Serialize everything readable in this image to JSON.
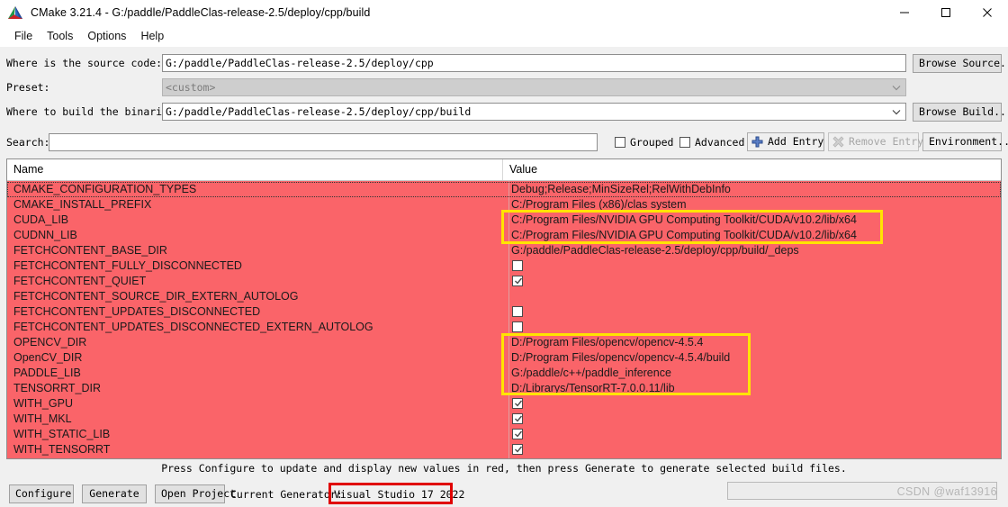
{
  "window": {
    "title": "CMake 3.21.4 - G:/paddle/PaddleClas-release-2.5/deploy/cpp/build",
    "logo_icon": "cmake-logo-icon",
    "minimize_icon": "minimize-icon",
    "maximize_icon": "maximize-icon",
    "close_icon": "close-icon"
  },
  "menu": {
    "items": [
      {
        "label": "File"
      },
      {
        "label": "Tools"
      },
      {
        "label": "Options"
      },
      {
        "label": "Help"
      }
    ]
  },
  "form": {
    "source_label": "Where is the source code:",
    "source_value": "G:/paddle/PaddleClas-release-2.5/deploy/cpp",
    "browse_source_label": "Browse Source...",
    "preset_label": "Preset:",
    "preset_value": "<custom>",
    "build_label": "Where to build the binaries:",
    "build_value": "G:/paddle/PaddleClas-release-2.5/deploy/cpp/build",
    "browse_build_label": "Browse Build...",
    "search_label": "Search:",
    "search_value": "",
    "grouped_label": "Grouped",
    "grouped_checked": false,
    "advanced_label": "Advanced",
    "advanced_checked": false,
    "add_entry_label": "Add Entry",
    "add_entry_icon": "plus-icon",
    "remove_entry_label": "Remove Entry",
    "remove_entry_icon": "remove-x-icon",
    "remove_entry_enabled": false,
    "environment_label": "Environment..."
  },
  "table": {
    "columns": [
      {
        "label": "Name"
      },
      {
        "label": "Value"
      }
    ],
    "rows": [
      {
        "name": "CMAKE_CONFIGURATION_TYPES",
        "value": "Debug;Release;MinSizeRel;RelWithDebInfo",
        "type": "text",
        "focused": true
      },
      {
        "name": "CMAKE_INSTALL_PREFIX",
        "value": "C:/Program Files (x86)/clas system",
        "type": "text"
      },
      {
        "name": "CUDA_LIB",
        "value": "C:/Program Files/NVIDIA GPU Computing Toolkit/CUDA/v10.2/lib/x64",
        "type": "text"
      },
      {
        "name": "CUDNN_LIB",
        "value": "C:/Program Files/NVIDIA GPU Computing Toolkit/CUDA/v10.2/lib/x64",
        "type": "text"
      },
      {
        "name": "FETCHCONTENT_BASE_DIR",
        "value": "G:/paddle/PaddleClas-release-2.5/deploy/cpp/build/_deps",
        "type": "text"
      },
      {
        "name": "FETCHCONTENT_FULLY_DISCONNECTED",
        "value": "",
        "type": "checkbox",
        "checked": false
      },
      {
        "name": "FETCHCONTENT_QUIET",
        "value": "",
        "type": "checkbox",
        "checked": true
      },
      {
        "name": "FETCHCONTENT_SOURCE_DIR_EXTERN_AUTOLOG",
        "value": "",
        "type": "text"
      },
      {
        "name": "FETCHCONTENT_UPDATES_DISCONNECTED",
        "value": "",
        "type": "checkbox",
        "checked": false
      },
      {
        "name": "FETCHCONTENT_UPDATES_DISCONNECTED_EXTERN_AUTOLOG",
        "value": "",
        "type": "checkbox",
        "checked": false
      },
      {
        "name": "OPENCV_DIR",
        "value": "D:/Program Files/opencv/opencv-4.5.4",
        "type": "text"
      },
      {
        "name": "OpenCV_DIR",
        "value": "D:/Program Files/opencv/opencv-4.5.4/build",
        "type": "text"
      },
      {
        "name": "PADDLE_LIB",
        "value": "G:/paddle/c++/paddle_inference",
        "type": "text"
      },
      {
        "name": "TENSORRT_DIR",
        "value": "D:/Librarys/TensorRT-7.0.0.11/lib",
        "type": "text"
      },
      {
        "name": "WITH_GPU",
        "value": "",
        "type": "checkbox",
        "checked": true
      },
      {
        "name": "WITH_MKL",
        "value": "",
        "type": "checkbox",
        "checked": true
      },
      {
        "name": "WITH_STATIC_LIB",
        "value": "",
        "type": "checkbox",
        "checked": true
      },
      {
        "name": "WITH_TENSORRT",
        "value": "",
        "type": "checkbox",
        "checked": true
      }
    ]
  },
  "highlights": {
    "cuda_box_color": "#FFE400",
    "opencv_box_color": "#FFE400",
    "generator_box_color": "#E00000"
  },
  "footer": {
    "hint": "Press Configure to update and display new values in red, then press Generate to generate selected build files.",
    "configure_label": "Configure",
    "generate_label": "Generate",
    "open_project_label": "Open Project",
    "current_generator_label": "Current Generator:",
    "current_generator_value": "Visual Studio 17 2022",
    "watermark": "CSDN @waf13916"
  }
}
